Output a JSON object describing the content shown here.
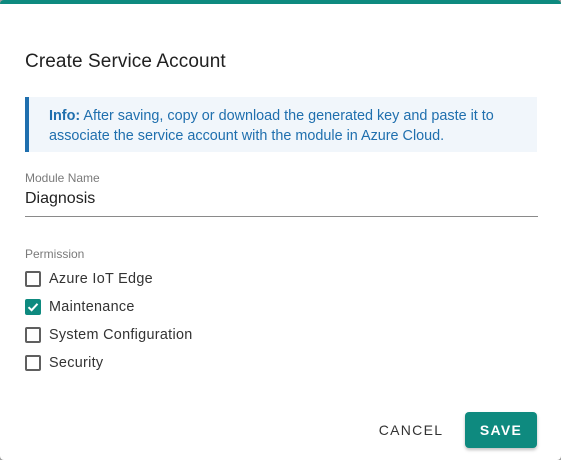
{
  "dialog": {
    "title": "Create Service Account",
    "accent_color": "#0e8a7f",
    "info_color": "#1f6fae"
  },
  "info": {
    "prefix": "Info:",
    "text": "After saving, copy or download the generated key and paste it to associate the service account with the module in Azure Cloud."
  },
  "module_name": {
    "label": "Module Name",
    "value": "Diagnosis"
  },
  "permission": {
    "label": "Permission",
    "items": [
      {
        "label": "Azure IoT Edge",
        "checked": false
      },
      {
        "label": "Maintenance",
        "checked": true
      },
      {
        "label": "System Configuration",
        "checked": false
      },
      {
        "label": "Security",
        "checked": false
      }
    ]
  },
  "actions": {
    "cancel_label": "CANCEL",
    "save_label": "SAVE"
  }
}
